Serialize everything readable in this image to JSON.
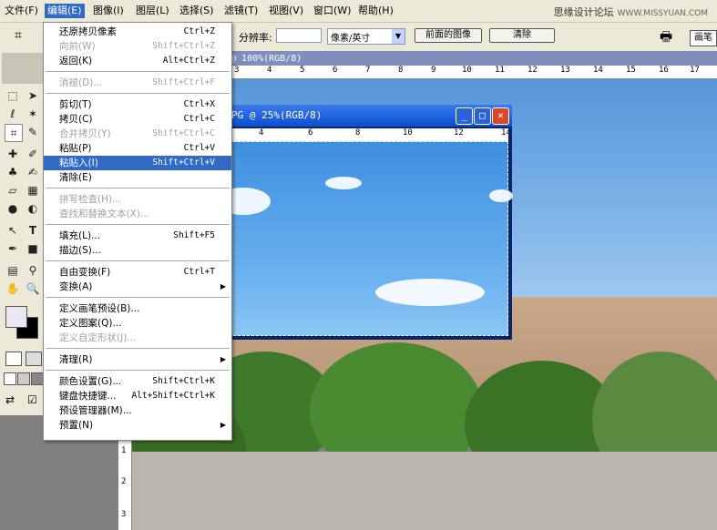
{
  "menubar": {
    "items": [
      {
        "label": "文件(F)"
      },
      {
        "label": "编辑(E)"
      },
      {
        "label": "图像(I)"
      },
      {
        "label": "图层(L)"
      },
      {
        "label": "选择(S)"
      },
      {
        "label": "滤镜(T)"
      },
      {
        "label": "视图(V)"
      },
      {
        "label": "窗口(W)"
      },
      {
        "label": "帮助(H)"
      }
    ],
    "watermark": "思缘设计论坛",
    "watermark_site": "WWW.MISSYUAN.COM"
  },
  "options_bar": {
    "resolution_label": "分辨率:",
    "resolution_value": "",
    "unit_select": "像素/英寸",
    "front_image_button": "前面的图像",
    "clear_button": "清除",
    "brush_tab": "画笔"
  },
  "main_document": {
    "title": "@ 100%(RGB/8)",
    "ruler_ticks": [
      "3",
      "4",
      "5",
      "6",
      "7",
      "8",
      "9",
      "10",
      "11",
      "12",
      "13",
      "14",
      "15",
      "16",
      "17"
    ],
    "vruler_ticks": [
      "1",
      "2",
      "3"
    ]
  },
  "doc_window": {
    "title": "PG @ 25%(RGB/8)",
    "ruler_ticks": [
      "4",
      "6",
      "8",
      "10",
      "12",
      "14"
    ]
  },
  "edit_menu": {
    "items": [
      {
        "label": "还原拷贝像素",
        "shortcut": "Ctrl+Z",
        "disabled": false
      },
      {
        "label": "向前(W)",
        "shortcut": "Shift+Ctrl+Z",
        "disabled": true
      },
      {
        "label": "返回(K)",
        "shortcut": "Alt+Ctrl+Z",
        "disabled": false
      },
      {
        "sep": true
      },
      {
        "label": "消褪(D)...",
        "shortcut": "Shift+Ctrl+F",
        "disabled": true
      },
      {
        "sep": true
      },
      {
        "label": "剪切(T)",
        "shortcut": "Ctrl+X",
        "disabled": false
      },
      {
        "label": "拷贝(C)",
        "shortcut": "Ctrl+C",
        "disabled": false
      },
      {
        "label": "合并拷贝(Y)",
        "shortcut": "Shift+Ctrl+C",
        "disabled": true
      },
      {
        "label": "粘贴(P)",
        "shortcut": "Ctrl+V",
        "disabled": false
      },
      {
        "label": "粘贴入(I)",
        "shortcut": "Shift+Ctrl+V",
        "disabled": false,
        "highlighted": true
      },
      {
        "label": "清除(E)",
        "shortcut": "",
        "disabled": false
      },
      {
        "sep": true
      },
      {
        "label": "拼写检查(H)...",
        "shortcut": "",
        "disabled": true
      },
      {
        "label": "查找和替换文本(X)...",
        "shortcut": "",
        "disabled": true
      },
      {
        "sep": true
      },
      {
        "label": "填充(L)...",
        "shortcut": "Shift+F5",
        "disabled": false
      },
      {
        "label": "描边(S)...",
        "shortcut": "",
        "disabled": false
      },
      {
        "sep": true
      },
      {
        "label": "自由变换(F)",
        "shortcut": "Ctrl+T",
        "disabled": false
      },
      {
        "label": "变换(A)",
        "shortcut": "",
        "disabled": false,
        "submenu": true
      },
      {
        "sep": true
      },
      {
        "label": "定义画笔预设(B)...",
        "shortcut": "",
        "disabled": false
      },
      {
        "label": "定义图案(Q)...",
        "shortcut": "",
        "disabled": false
      },
      {
        "label": "定义自定形状(J)...",
        "shortcut": "",
        "disabled": true
      },
      {
        "sep": true
      },
      {
        "label": "清理(R)",
        "shortcut": "",
        "disabled": false,
        "submenu": true
      },
      {
        "sep": true
      },
      {
        "label": "颜色设置(G)...",
        "shortcut": "Shift+Ctrl+K",
        "disabled": false
      },
      {
        "label": "键盘快捷键...",
        "shortcut": "Alt+Shift+Ctrl+K",
        "disabled": false
      },
      {
        "label": "预设管理器(M)...",
        "shortcut": "",
        "disabled": false
      },
      {
        "label": "预置(N)",
        "shortcut": "",
        "disabled": false,
        "submenu": true
      }
    ]
  },
  "colors": {
    "menu_highlight": "#316ac5",
    "chrome": "#ece9d8",
    "xp_title": "#0a4fd0",
    "close_button": "#d9482a"
  },
  "toolbox": {
    "tools": [
      "marquee-icon",
      "move-icon",
      "lasso-icon",
      "magic-wand-icon",
      "crop-icon",
      "slice-icon",
      "healing-brush-icon",
      "brush-icon",
      "stamp-icon",
      "history-brush-icon",
      "eraser-icon",
      "gradient-icon",
      "blur-icon",
      "dodge-icon",
      "path-select-icon",
      "type-icon",
      "pen-icon",
      "shape-icon",
      "notes-icon",
      "eyedropper-icon",
      "hand-icon",
      "zoom-icon"
    ]
  }
}
